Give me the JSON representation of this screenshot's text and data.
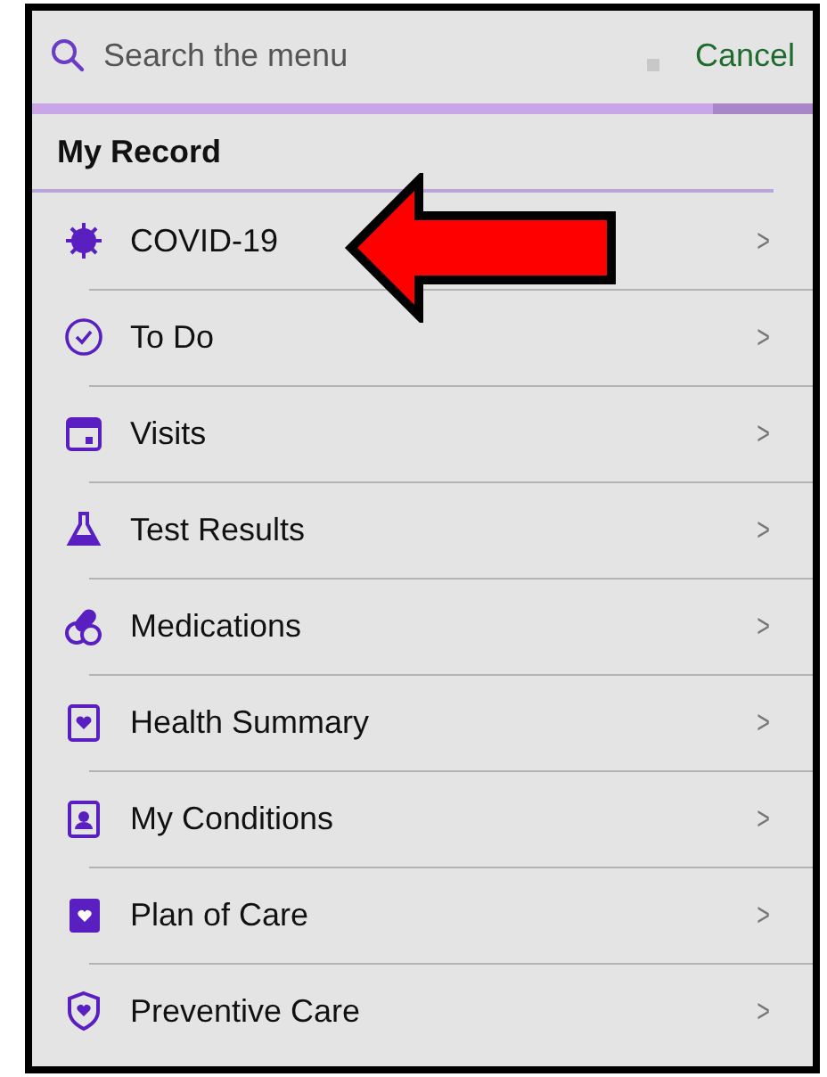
{
  "search": {
    "placeholder": "Search the menu"
  },
  "cancel": "Cancel",
  "section": {
    "title": "My Record",
    "items": [
      {
        "label": "COVID-19",
        "chevron": ">"
      },
      {
        "label": "To Do",
        "chevron": ">"
      },
      {
        "label": "Visits",
        "chevron": ">"
      },
      {
        "label": "Test Results",
        "chevron": ">"
      },
      {
        "label": "Medications",
        "chevron": ">"
      },
      {
        "label": "Health Summary",
        "chevron": ">"
      },
      {
        "label": "My Conditions",
        "chevron": ">"
      },
      {
        "label": "Plan of Care",
        "chevron": ">"
      },
      {
        "label": "Preventive Care",
        "chevron": ">"
      }
    ]
  }
}
